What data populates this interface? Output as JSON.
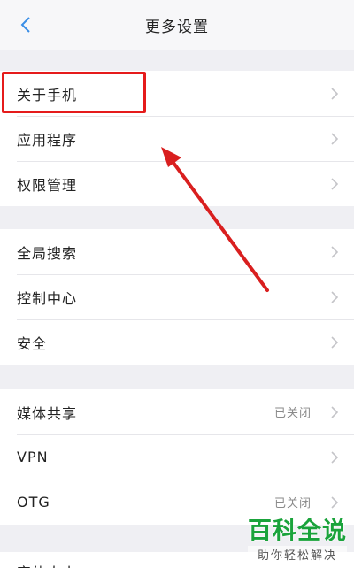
{
  "header": {
    "title": "更多设置",
    "back_icon": "chevron-left-icon"
  },
  "groups": [
    {
      "items": [
        {
          "label": "关于手机"
        },
        {
          "label": "应用程序"
        },
        {
          "label": "权限管理"
        }
      ]
    },
    {
      "items": [
        {
          "label": "全局搜索"
        },
        {
          "label": "控制中心"
        },
        {
          "label": "安全"
        }
      ]
    },
    {
      "items": [
        {
          "label": "媒体共享",
          "value": "已关闭"
        },
        {
          "label": "VPN"
        },
        {
          "label": "OTG",
          "value": "已关闭"
        },
        {
          "label": "字体大小"
        }
      ]
    }
  ],
  "watermark": {
    "main": "百科全说",
    "sub": "助你轻松解决"
  },
  "colors": {
    "accent": "#3a8ee6",
    "highlight": "#e51b1b",
    "watermark": "#1aa33b"
  }
}
